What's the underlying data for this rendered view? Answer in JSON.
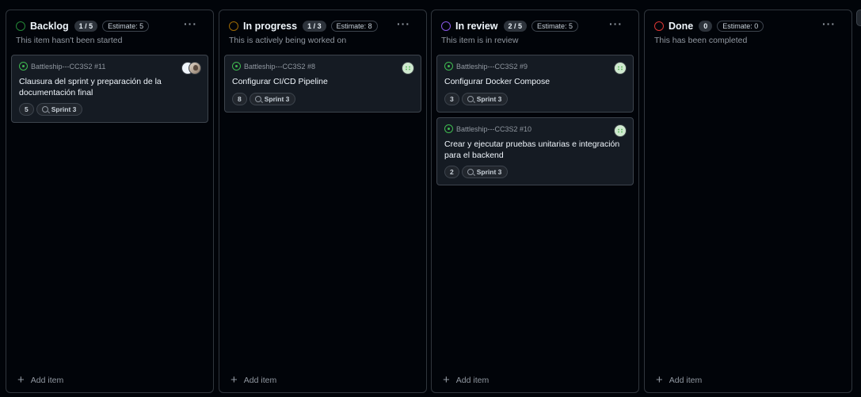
{
  "columns": [
    {
      "title": "Backlog",
      "count": "1 / 5",
      "estimate": "Estimate: 5",
      "description": "This item hasn't been started",
      "status_color": "#238636",
      "menu": "···",
      "add_label": "Add item",
      "cards": [
        {
          "repo": "Battleship---CC3S2 #11",
          "title": "Clausura del sprint y preparación de la documentación final",
          "points": "5",
          "sprint": "Sprint 3"
        }
      ]
    },
    {
      "title": "In progress",
      "count": "1 / 3",
      "estimate": "Estimate: 8",
      "description": "This is actively being worked on",
      "status_color": "#9e6a03",
      "menu": "···",
      "add_label": "Add item",
      "cards": [
        {
          "repo": "Battleship---CC3S2 #8",
          "title": "Configurar CI/CD Pipeline",
          "points": "8",
          "sprint": "Sprint 3"
        }
      ]
    },
    {
      "title": "In review",
      "count": "2 / 5",
      "estimate": "Estimate: 5",
      "description": "This item is in review",
      "status_color": "#8957e5",
      "menu": "···",
      "add_label": "Add item",
      "cards": [
        {
          "repo": "Battleship---CC3S2 #9",
          "title": "Configurar Docker Compose",
          "points": "3",
          "sprint": "Sprint 3"
        },
        {
          "repo": "Battleship---CC3S2 #10",
          "title": "Crear y ejecutar pruebas unitarias e integración para el backend",
          "points": "2",
          "sprint": "Sprint 3"
        }
      ]
    },
    {
      "title": "Done",
      "count": "0",
      "estimate": "Estimate: 0",
      "description": "This has been completed",
      "status_color": "#da3633",
      "menu": "···",
      "add_label": "Add item",
      "cards": []
    }
  ],
  "icons": {
    "status": "circle-status-icon",
    "issue": "issue-opened-icon",
    "iteration": "iteration-icon",
    "add": "plus-icon",
    "menu": "kebab-horizontal-icon"
  },
  "colors": {
    "background": "#010409",
    "card": "#151b23",
    "border": "#30363d",
    "issue_open": "#3fb950"
  }
}
